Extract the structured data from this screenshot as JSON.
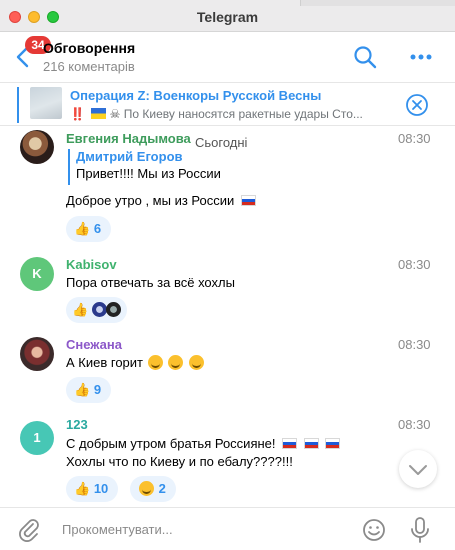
{
  "window": {
    "title": "Telegram"
  },
  "header": {
    "badge": "34",
    "title": "Обговорення",
    "subtitle": "216 коментарів"
  },
  "pinned": {
    "title": "Операция Z: Военкоры Русской Весны",
    "text": "По Киеву наносятся ракетные удары  Сто...",
    "icons": [
      "double-exclamation-icon",
      "ukraine-flag-icon",
      "skull-crossbones-icon"
    ]
  },
  "date_chip": "Сьогодні",
  "messages": [
    {
      "author": "Евгения Надымова",
      "author_color": "#3e9c5c",
      "time": "08:30",
      "reply": {
        "name": "Дмитрий Егоров",
        "text": "Привет!!!! Мы из России"
      },
      "text": "Доброе утро , мы из России",
      "text_suffix": "russia-flag-icon",
      "reactions": [
        {
          "emoji": "thumbs-up-icon",
          "count": "6"
        }
      ]
    },
    {
      "author": "Kabisov",
      "author_color": "#3fb26e",
      "avatar_letter": "K",
      "avatar_color": "#5fc77a",
      "time": "08:30",
      "text": "Пора отвечать за всё хохлы",
      "reactions": [
        {
          "emoji": "thumbs-up-icon",
          "count": ""
        }
      ]
    },
    {
      "author": "Снежана",
      "author_color": "#8c58c9",
      "time": "08:30",
      "text": "А Киев горит",
      "text_suffix": "grinning-face-icon",
      "reactions": [
        {
          "emoji": "thumbs-up-icon",
          "count": "9"
        }
      ]
    },
    {
      "author": "123",
      "author_color": "#2aa9a0",
      "avatar_letter": "1",
      "avatar_color": "#47c7b5",
      "time": "08:30",
      "text_lines": [
        "С добрым утром братья Россияне!",
        "Хохлы что по Киеву и по ебалу????!!!"
      ],
      "text_suffix": "russia-flag-icon",
      "reactions": [
        {
          "emoji": "thumbs-up-icon",
          "count": "10"
        },
        {
          "emoji": "grinning-face-icon",
          "count": "2"
        }
      ]
    }
  ],
  "composer": {
    "placeholder": "Прокоментувати..."
  },
  "colors": {
    "accent": "#3390ec",
    "badge": "#e53935",
    "reaction_bg": "#eaf3fd"
  }
}
